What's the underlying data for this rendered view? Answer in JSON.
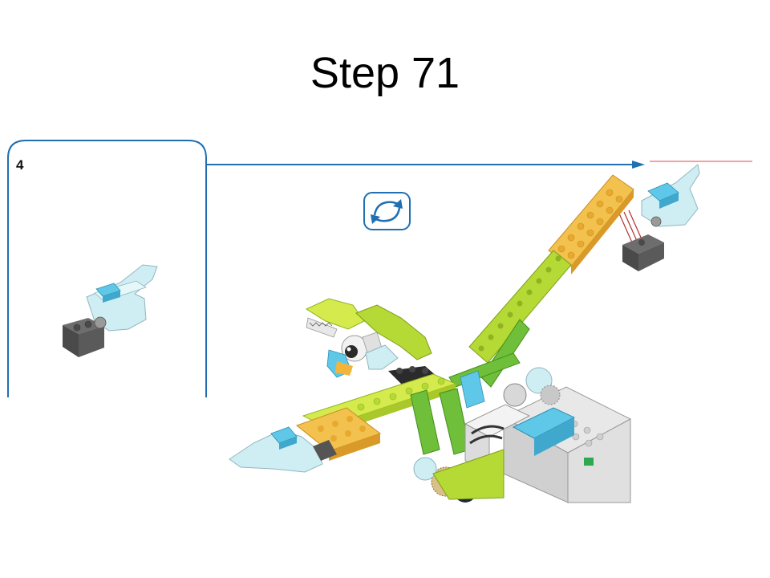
{
  "slide": {
    "title": "Step 71"
  },
  "callout": {
    "step_number": "4",
    "frame_color": "#1f6fb2"
  },
  "rotate_icon": {
    "icon": "rotate-model-icon",
    "color": "#1f6fb2"
  },
  "model": {
    "colors": {
      "lime": "#b5d935",
      "lime_dark": "#8fb41f",
      "green": "#6fbf3a",
      "yellow_orange": "#f2c14e",
      "orange_dark": "#d99a2a",
      "trans_light_blue": "#bfe8ef",
      "azure": "#5fc8e8",
      "dark_gray": "#5a5a5a",
      "light_gray": "#d8d8d8",
      "white": "#f3f3f3",
      "black": "#222222"
    }
  }
}
